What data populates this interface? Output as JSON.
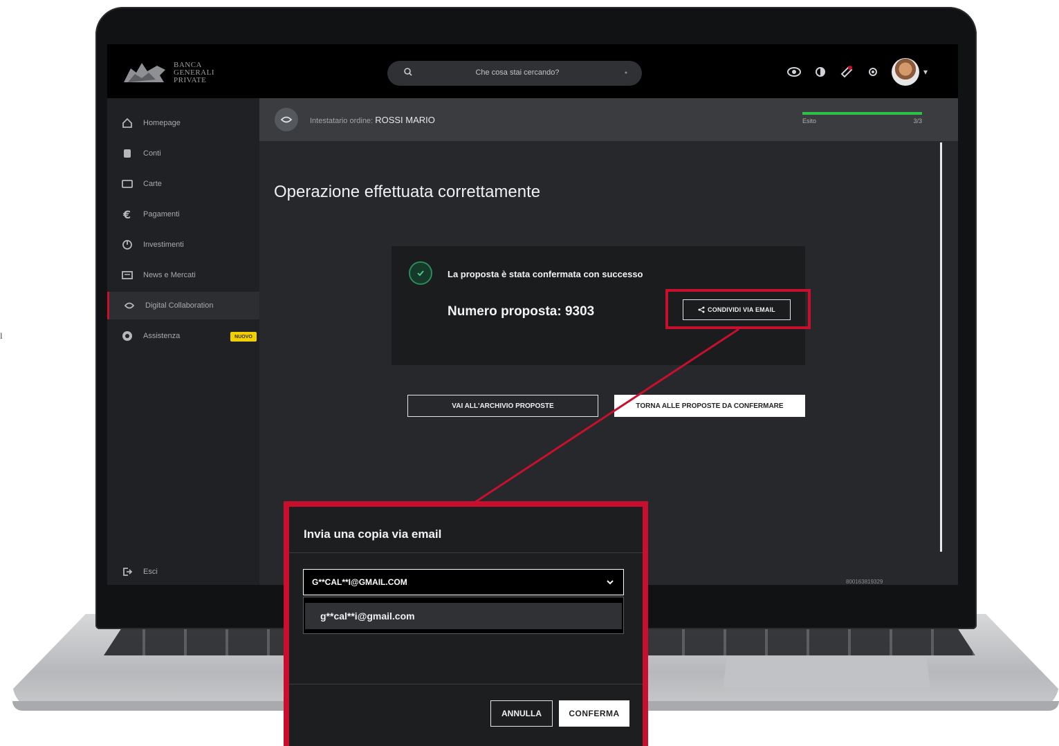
{
  "colors": {
    "accent_red": "#c8102e",
    "success_green": "#2fbf4a",
    "badge_yellow": "#f0d000",
    "screen_bg": "#26282b"
  },
  "topbar": {
    "logo_lines": [
      "BANCA",
      "GENERALI",
      "PRIVATE"
    ],
    "search_placeholder": "Che cosa stai cercando?",
    "icons": [
      "eye-icon",
      "contrast-icon",
      "notification-icon",
      "settings-icon"
    ]
  },
  "sidebar": {
    "items": [
      {
        "label": "Homepage",
        "icon": "home-icon"
      },
      {
        "label": "Conti",
        "icon": "piggy-bank-icon"
      },
      {
        "label": "Carte",
        "icon": "card-icon"
      },
      {
        "label": "Pagamenti",
        "icon": "euro-icon"
      },
      {
        "label": "Investimenti",
        "icon": "chart-pie-icon"
      },
      {
        "label": "News e Mercati",
        "icon": "news-icon"
      },
      {
        "label": "Digital Collaboration",
        "icon": "collaboration-icon",
        "active": true
      },
      {
        "label": "Assistenza",
        "icon": "help-icon",
        "badge": "NUOVO"
      }
    ],
    "exit_label": "Esci"
  },
  "order": {
    "label_prefix": "Intestatario ordine:",
    "holder_name": "ROSSI MARIO",
    "progress_label": "Esito",
    "step": "3/3",
    "progress_fraction": 1.0
  },
  "main": {
    "title": "Operazione effettuata correttamente",
    "confirm_message": "La proposta è stata confermata con successo",
    "proposal_number": "Numero proposta: 9303",
    "share_button": "CONDIVIDI VIA EMAIL",
    "archive_button": "VAI ALL'ARCHIVIO PROPOSTE",
    "back_button": "TORNA ALLE PROPOSTE DA CONFERMARE",
    "footer_code": "800163819329"
  },
  "modal": {
    "title": "Invia una copia via email",
    "selected_email": "G**CAL**I@GMAIL.COM",
    "options": [
      "g**cal**i@gmail.com"
    ],
    "cancel_button": "ANNULLA",
    "confirm_button": "CONFERMA"
  },
  "page_edge_mark": "l"
}
